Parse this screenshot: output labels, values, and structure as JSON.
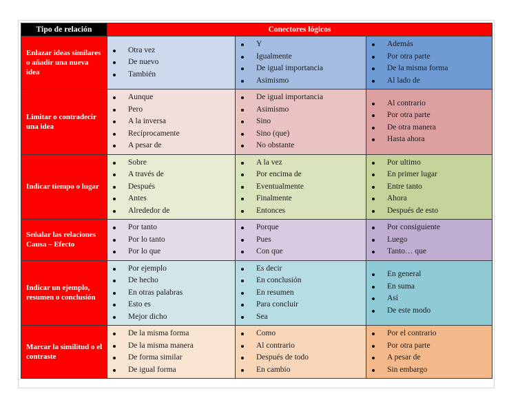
{
  "table": {
    "header": {
      "type_label": "Tipo de relación",
      "connectors_label": "Conectores lógicos"
    },
    "rows": [
      {
        "label": "Enlazar ideas similares o añadir una nueva idea",
        "colors": [
          "#cdd9ec",
          "#a3bcdf",
          "#6e9bd3"
        ],
        "columns": [
          [
            "Otra vez",
            "De nuevo",
            "También"
          ],
          [
            "Y",
            "Igualmente",
            "De igual importancia",
            "Asimismo"
          ],
          [
            "Además",
            "Por otra parte",
            "De la misma forma",
            "Al lado de"
          ]
        ]
      },
      {
        "label": "Limitar o contradecir una idea",
        "colors": [
          "#f2dedc",
          "#e8c3c2",
          "#dda0a0"
        ],
        "columns": [
          [
            "Aunque",
            "Pero",
            "A la inversa",
            "Recíprocamente",
            "A pesar de"
          ],
          [
            "De igual importancia",
            "Asimismo",
            "Sino",
            "Sino (que)",
            "No obstante"
          ],
          [
            "Al contrario",
            "Por otra parte",
            "De otra manera",
            "Hasta ahora"
          ]
        ]
      },
      {
        "label": "Indicar tiempo o lugar",
        "colors": [
          "#e7ecd3",
          "#d9e3bc",
          "#c3d39a"
        ],
        "columns": [
          [
            "Sobre",
            "A través de",
            "Después",
            "Antes",
            "Alrededor de"
          ],
          [
            "A la vez",
            "Por encima de",
            "Eventualmente",
            "Finalmente",
            "Entonces"
          ],
          [
            "Por ultimo",
            "En primer lugar",
            "Entre tanto",
            "Ahora",
            "Después de esto"
          ]
        ]
      },
      {
        "label": "Señalar las relaciones Causa – Efecto",
        "colors": [
          "#e3dbe8",
          "#d6cbe0",
          "#bfaed2"
        ],
        "columns": [
          [
            "Por tanto",
            "Por lo tanto",
            "Por lo que"
          ],
          [
            "Porque",
            "Pues",
            "Con que"
          ],
          [
            "Por consiguiente",
            "Luego",
            "Tanto… que"
          ]
        ]
      },
      {
        "label": "Indicar un ejemplo, resumen o conclusión",
        "colors": [
          "#d2e6ea",
          "#b8dce4",
          "#8ecbd6"
        ],
        "columns": [
          [
            "Por ejemplo",
            "De hecho",
            "En otras palabras",
            "Esto es",
            "Mejor dicho"
          ],
          [
            "Es decir",
            "En conclusión",
            "En resumen",
            "Para concluir",
            "Sea"
          ],
          [
            "En general",
            "En suma",
            "Así",
            "De este modo"
          ]
        ]
      },
      {
        "label": "Marcar la similitud o el contraste",
        "colors": [
          "#fae5d3",
          "#f7d6ba",
          "#f4b98a"
        ],
        "columns": [
          [
            "De la misma forma",
            "De la misma manera",
            "De forma similar",
            "De igual forma"
          ],
          [
            "Como",
            "Al contrario",
            "Después de todo",
            "En cambio"
          ],
          [
            "Por el contrario",
            "Por otra parte",
            "A pesar de",
            "Sin embargo"
          ]
        ]
      }
    ]
  }
}
